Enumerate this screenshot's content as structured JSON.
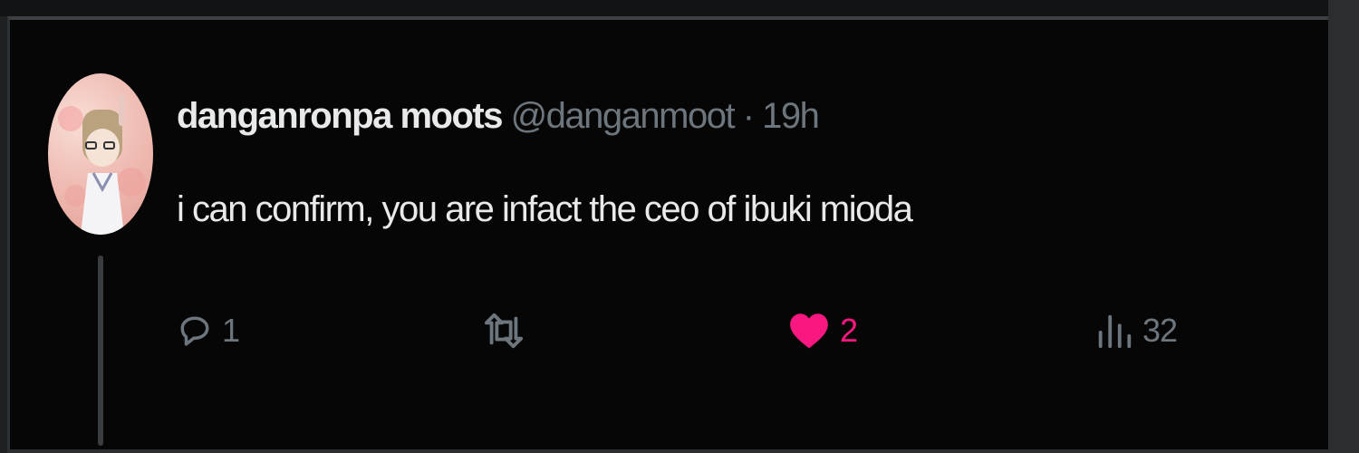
{
  "tweet": {
    "display_name": "danganronpa moots",
    "handle": "@danganmoot",
    "separator": "·",
    "time": "19h",
    "text": "i can confirm, you are infact the ceo of ibuki mioda"
  },
  "actions": {
    "reply": {
      "icon": "reply-icon",
      "count": "1"
    },
    "retweet": {
      "icon": "retweet-icon",
      "count": ""
    },
    "like": {
      "icon": "heart-icon",
      "count": "2",
      "liked": true
    },
    "views": {
      "icon": "views-icon",
      "count": "32"
    }
  },
  "colors": {
    "background": "#060606",
    "primary_text": "#e8e9ea",
    "secondary_text": "#6e767d",
    "like_active": "#f91880",
    "thread_line": "#3a3d40"
  }
}
